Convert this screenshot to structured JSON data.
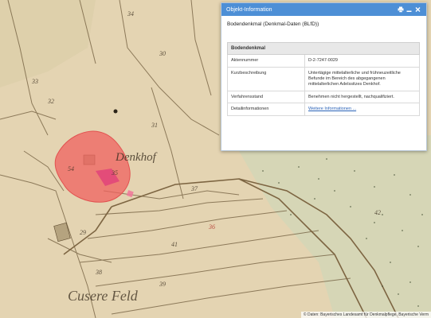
{
  "panel": {
    "title": "Objekt-Information",
    "subtitle": "Bodendenkmal (Denkmal-Daten (BLfD))",
    "table_header": "Bodendenkmal",
    "rows": [
      {
        "key": "Aktennummer",
        "value": "D-2-7247-0029"
      },
      {
        "key": "Kurzbeschreibung",
        "value": "Untertägige mittelalterliche und frühneuzeitliche Befunde im Bereich des abgegangenen mittelalterlichen Adelssitzes Denkhof."
      },
      {
        "key": "Verfahrensstand",
        "value": "Benehmen nicht hergestellt, nachqualifiziert."
      },
      {
        "key": "Detailinformationen",
        "value": "Weitere Informationen ..."
      }
    ],
    "icons": [
      "print-icon",
      "minimize-icon",
      "close-icon"
    ]
  },
  "map": {
    "labels": {
      "denkhof": "Denkhof",
      "feld": "Cusere Feld",
      "parcels": [
        "34",
        "35",
        "33",
        "36",
        "37",
        "38",
        "39",
        "41",
        "42",
        "29",
        "30",
        "31",
        "32",
        "54"
      ]
    },
    "highlight_color": "#f0625f"
  },
  "attribution": "© Daten: Bayerisches Landesamt für Denkmalpflege, Bayerische Verm"
}
